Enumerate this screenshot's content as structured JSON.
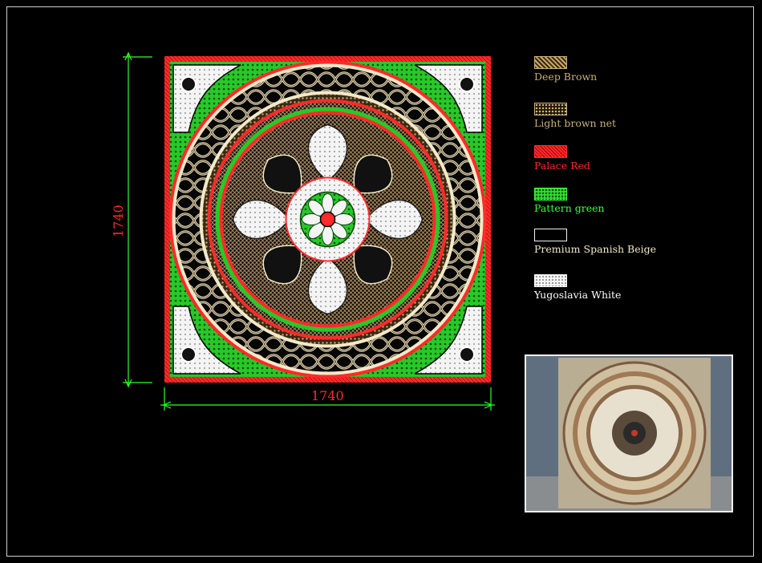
{
  "dimensions": {
    "width_label": "1740",
    "height_label": "1740"
  },
  "legend": [
    {
      "label": "Deep Brown",
      "color": "#c9b07a",
      "pattern": "deep-brown"
    },
    {
      "label": "Light brown net",
      "color": "#c9b07a",
      "pattern": "net"
    },
    {
      "label": "Palace Red",
      "color": "#ff2a2a",
      "pattern": "red"
    },
    {
      "label": "Pattern green",
      "color": "#3cff3c",
      "pattern": "green"
    },
    {
      "label": "Premium Spanish Beige",
      "color": "#f2e9c8",
      "pattern": "blank"
    },
    {
      "label": "Yugoslavia White",
      "color": "#ffffff",
      "pattern": "white"
    }
  ],
  "colors": {
    "background": "#000000",
    "dimension_line": "#2cff2c",
    "dimension_text": "#ff2a2a",
    "palace_red": "#ff2a2a",
    "pattern_green": "#33dd33",
    "deep_brown": "#8a6a3a",
    "beige": "#f2e9c8",
    "white": "#ffffff"
  }
}
